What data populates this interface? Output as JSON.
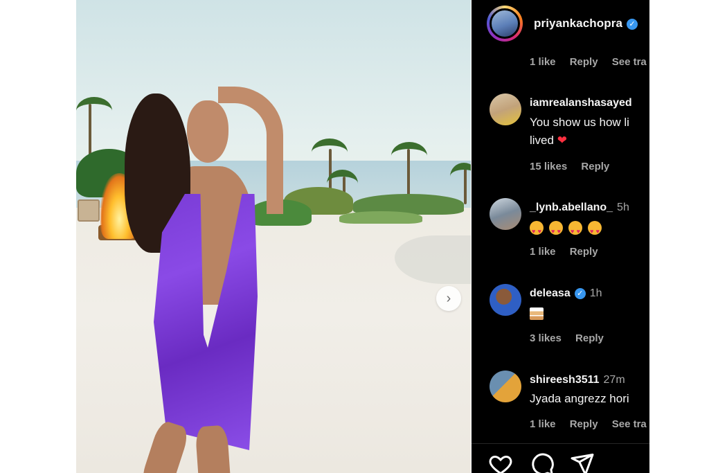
{
  "post": {
    "author": "priyankachopra",
    "verified": true,
    "carousel_next_icon": "chevron-right-icon"
  },
  "top_comment_meta": {
    "likes": "1 like",
    "reply": "Reply",
    "see_translation": "See tra"
  },
  "comments": [
    {
      "user": "iamrealanshasayed",
      "user_visible": "iamrealanshasayed",
      "time": "",
      "text_line1": "You show us how li",
      "text_line2": "lived",
      "emoji": "red-heart",
      "likes": "15 likes",
      "reply": "Reply"
    },
    {
      "user": "_lynb.abellano_",
      "time": "5h",
      "emoji": "heart-eyes x4",
      "likes": "1 like",
      "reply": "Reply"
    },
    {
      "user": "deleasa",
      "verified": true,
      "time": "1h",
      "emoji": "birthday-cake",
      "likes": "3 likes",
      "reply": "Reply"
    },
    {
      "user": "shireesh3511",
      "time": "27m",
      "text_line1": "Jyada angrezz hori",
      "likes": "1 like",
      "reply": "Reply",
      "see_translation": "See tra"
    }
  ],
  "actions": [
    "heart-icon",
    "comment-icon",
    "share-icon"
  ],
  "colors": {
    "panel_bg": "#000000",
    "meta_text": "#a8a8a8",
    "verified": "#3897f0",
    "heart": "#ff3040",
    "dress": "#7a3cd6"
  }
}
